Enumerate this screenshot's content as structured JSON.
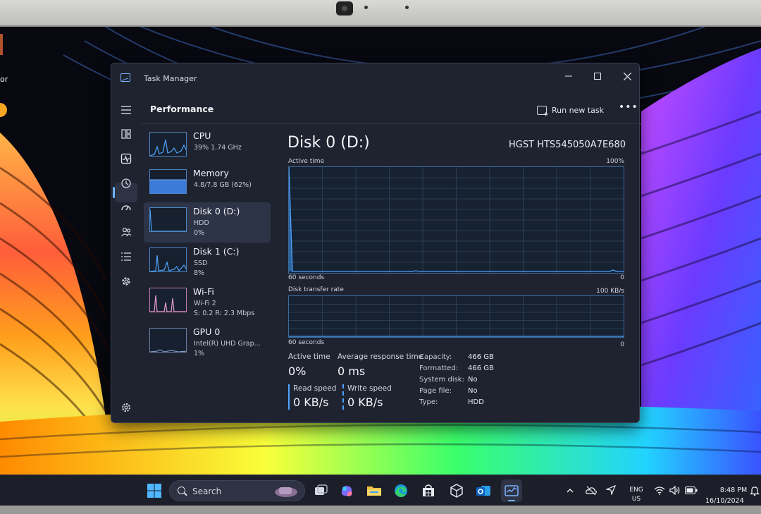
{
  "window": {
    "title": "Task Manager"
  },
  "header": {
    "title": "Performance",
    "run_new_task": "Run new task",
    "more": "•••"
  },
  "sidebar": [
    {
      "name": "CPU",
      "line1": "39%  1.74 GHz",
      "line2": ""
    },
    {
      "name": "Memory",
      "line1": "4.8/7.8 GB (62%)",
      "line2": ""
    },
    {
      "name": "Disk 0 (D:)",
      "line1": "HDD",
      "line2": "0%"
    },
    {
      "name": "Disk 1 (C:)",
      "line1": "SSD",
      "line2": "8%"
    },
    {
      "name": "Wi-Fi",
      "line1": "Wi-Fi 2",
      "line2": "S: 0.2  R: 2.3 Mbps"
    },
    {
      "name": "GPU 0",
      "line1": "Intel(R) UHD Grap...",
      "line2": "1%"
    }
  ],
  "detail": {
    "title": "Disk 0 (D:)",
    "model": "HGST HTS545050A7E680",
    "graph1": {
      "label": "Active time",
      "max": "100%",
      "time": "60 seconds",
      "min": "0"
    },
    "graph2": {
      "label": "Disk transfer rate",
      "max": "100 KB/s",
      "time": "60 seconds",
      "min": "0"
    },
    "stats": {
      "active_time_label": "Active time",
      "active_time_value": "0%",
      "avg_response_label": "Average response time",
      "avg_response_value": "0 ms",
      "read_speed_label": "Read speed",
      "read_speed_value": "0 KB/s",
      "write_speed_label": "Write speed",
      "write_speed_value": "0 KB/s"
    },
    "properties": [
      {
        "label": "Capacity:",
        "value": "466 GB"
      },
      {
        "label": "Formatted:",
        "value": "466 GB"
      },
      {
        "label": "System disk:",
        "value": "No"
      },
      {
        "label": "Page file:",
        "value": "No"
      },
      {
        "label": "Type:",
        "value": "HDD"
      }
    ]
  },
  "taskbar": {
    "search_label": "Search",
    "lang": "ENG",
    "region": "US",
    "time": "8:48 PM",
    "date": "16/10/2024"
  },
  "desktop": {
    "partial_label": "or"
  },
  "colors": {
    "accent": "#6fb3ff",
    "window_bg": "#1f2330",
    "disk_line": "#4ea3ff",
    "memory_fill": "#3d7bd9",
    "wifi_line": "#e59bd1"
  }
}
